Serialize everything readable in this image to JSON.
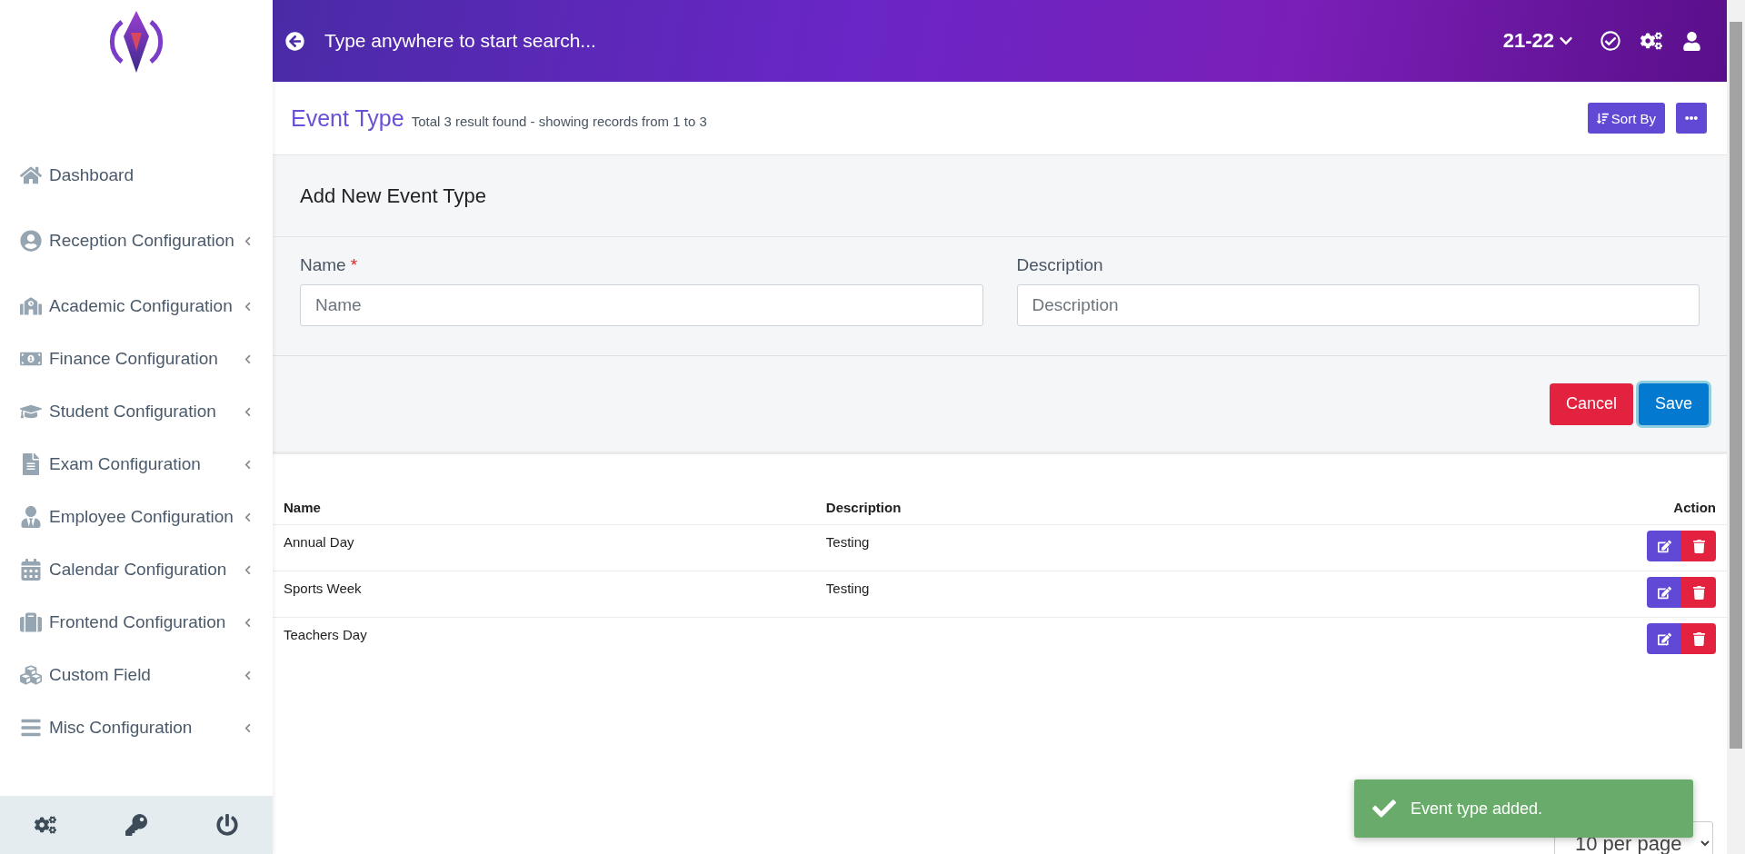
{
  "sidebar": {
    "items": [
      {
        "label": "Dashboard",
        "has_submenu": false
      },
      {
        "label": "Reception Configuration",
        "has_submenu": true
      },
      {
        "label": "Academic Configuration",
        "has_submenu": true
      },
      {
        "label": "Finance Configuration",
        "has_submenu": true
      },
      {
        "label": "Student Configuration",
        "has_submenu": true
      },
      {
        "label": "Exam Configuration",
        "has_submenu": true
      },
      {
        "label": "Employee Configuration",
        "has_submenu": true
      },
      {
        "label": "Calendar Configuration",
        "has_submenu": true
      },
      {
        "label": "Frontend Configuration",
        "has_submenu": true
      },
      {
        "label": "Custom Field",
        "has_submenu": true
      },
      {
        "label": "Misc Configuration",
        "has_submenu": true
      }
    ]
  },
  "header": {
    "search_placeholder": "Type anywhere to start search...",
    "session": "21-22"
  },
  "page": {
    "title": "Event Type",
    "summary": "Total 3 result found - showing records from 1 to 3",
    "sort_button": "Sort By"
  },
  "form": {
    "title": "Add New Event Type",
    "required_mark": "*",
    "fields": [
      {
        "label": "Name",
        "required": true,
        "placeholder": "Name"
      },
      {
        "label": "Description",
        "required": false,
        "placeholder": "Description"
      }
    ],
    "buttons": {
      "cancel": "Cancel",
      "save": "Save"
    }
  },
  "table": {
    "columns": [
      "Name",
      "Description",
      "Action"
    ],
    "rows": [
      {
        "name": "Annual Day",
        "description": "Testing"
      },
      {
        "name": "Sports Week",
        "description": "Testing"
      },
      {
        "name": "Teachers Day"
      }
    ]
  },
  "pagination": {
    "per_page": "10 per page"
  },
  "toast": {
    "message": "Event type added."
  }
}
